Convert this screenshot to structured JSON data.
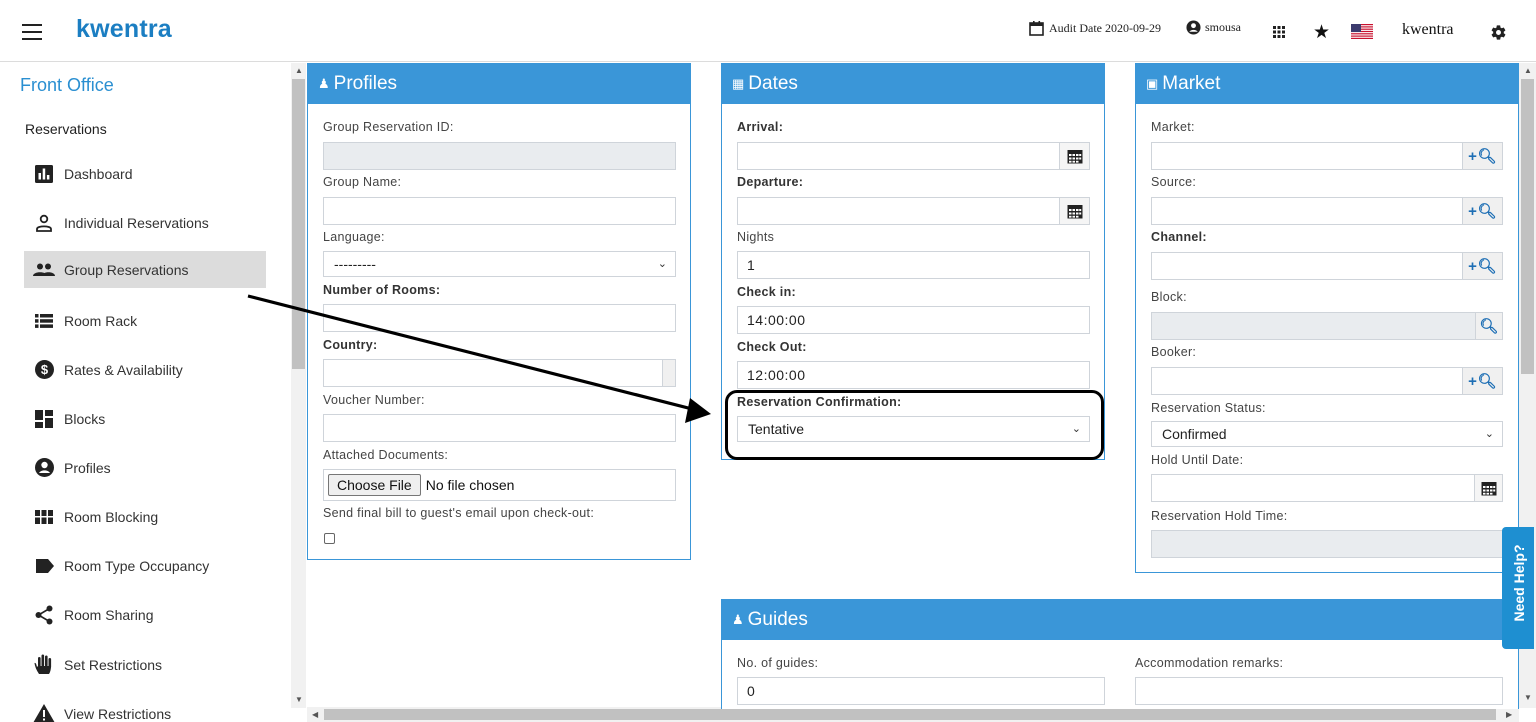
{
  "header": {
    "logo": "kwentra",
    "audit_date": "Audit Date 2020-09-29",
    "username": "smousa",
    "brand": "kwentra",
    "flag_icon": "us-flag-icon"
  },
  "sidebar": {
    "title": "Front Office",
    "section": "Reservations",
    "items": [
      {
        "label": "Dashboard",
        "icon": "bar-chart-icon"
      },
      {
        "label": "Individual Reservations",
        "icon": "person-icon"
      },
      {
        "label": "Group Reservations",
        "icon": "people-icon",
        "active": true
      },
      {
        "label": "Room Rack",
        "icon": "list-icon"
      },
      {
        "label": "Rates & Availability",
        "icon": "dollar-icon"
      },
      {
        "label": "Blocks",
        "icon": "dashboard-blocks-icon"
      },
      {
        "label": "Profiles",
        "icon": "account-circle-icon"
      },
      {
        "label": "Room Blocking",
        "icon": "grid-icon"
      },
      {
        "label": "Room Type Occupancy",
        "icon": "label-tag-icon"
      },
      {
        "label": "Room Sharing",
        "icon": "share-icon"
      },
      {
        "label": "Set Restrictions",
        "icon": "hand-icon"
      },
      {
        "label": "View Restrictions",
        "icon": "warning-icon"
      }
    ]
  },
  "profiles": {
    "title": "Profiles",
    "group_reservation_id_label": "Group Reservation ID:",
    "group_reservation_id_value": "",
    "group_name_label": "Group Name:",
    "group_name_value": "",
    "language_label": "Language:",
    "language_value": "---------",
    "rooms_label": "Number of Rooms:",
    "rooms_value": "",
    "country_label": "Country:",
    "country_value": "",
    "voucher_label": "Voucher Number:",
    "voucher_value": "",
    "attached_label": "Attached Documents:",
    "choose_file": "Choose File",
    "no_file": "No file chosen",
    "send_bill_label": "Send final bill to guest's email upon check-out:"
  },
  "dates": {
    "title": "Dates",
    "arrival_label": "Arrival:",
    "arrival_value": "",
    "departure_label": "Departure:",
    "departure_value": "",
    "nights_label": "Nights",
    "nights_value": "1",
    "checkin_label": "Check in:",
    "checkin_value": "14:00:00",
    "checkout_label": "Check Out:",
    "checkout_value": "12:00:00",
    "confirmation_label": "Reservation Confirmation:",
    "confirmation_value": "Tentative"
  },
  "market": {
    "title": "Market",
    "market_label": "Market:",
    "source_label": "Source:",
    "channel_label": "Channel:",
    "block_label": "Block:",
    "booker_label": "Booker:",
    "status_label": "Reservation Status:",
    "status_value": "Confirmed",
    "hold_date_label": "Hold Until Date:",
    "hold_time_label": "Reservation Hold Time:"
  },
  "guides": {
    "title": "Guides",
    "count_label": "No. of guides:",
    "count_value": "0",
    "remarks_label": "Accommodation remarks:",
    "remarks_value": ""
  },
  "help": {
    "label": "Need Help?"
  },
  "colors": {
    "accent": "#3a96d8",
    "brand": "#1b7ec2",
    "sidebar_title": "#2a8fd1"
  }
}
